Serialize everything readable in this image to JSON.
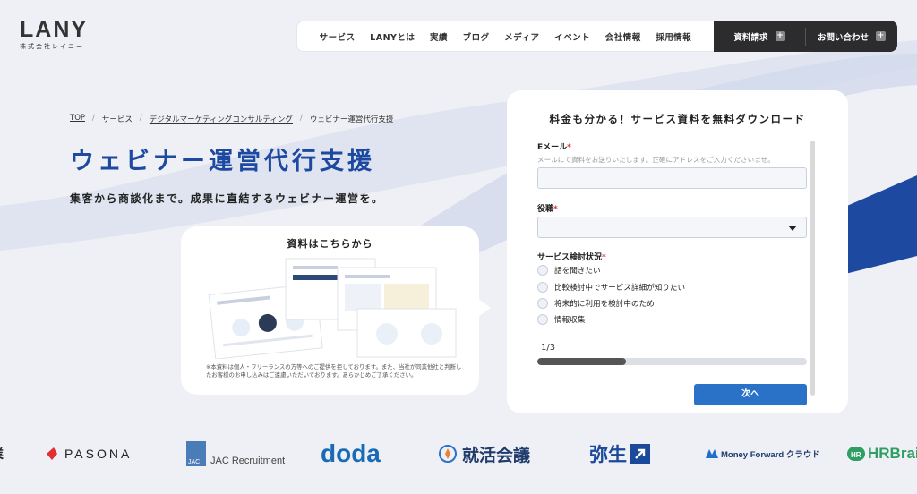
{
  "header": {
    "logo_text": "LANY",
    "logo_sub": "株式会社レイニー",
    "nav": [
      "サービス",
      "LANYとは",
      "実績",
      "ブログ",
      "メディア",
      "イベント",
      "会社情報",
      "採用情報"
    ],
    "cta_doc": "資料請求",
    "cta_contact": "お問い合わせ",
    "cta_icon": "plus-icon"
  },
  "breadcrumb": [
    "TOP",
    "サービス",
    "デジタルマーケティングコンサルティング",
    "ウェビナー運営代行支援"
  ],
  "breadcrumb_sep": "/",
  "hero": {
    "title": "ウェビナー運営代行支援",
    "lead": "集客から商談化まで。成果に直結するウェビナー運営を。"
  },
  "doc_card": {
    "title": "資料はこちらから",
    "note": "※本資料は個人・フリーランスの方等へのご提供を拒しております。また、当社が同業他社と判断したお客様のお申し込みはご遠慮いただいております。あらかじめご了承ください。"
  },
  "form": {
    "title": "料金も分かる！サービス資料を無料ダウンロード",
    "email_label": "Eメール",
    "required_mark": "*",
    "email_hint": "メールにて資料をお送りいたします。正確にアドレスをご入力くださいませ。",
    "email_value": "",
    "role_label": "役職",
    "role_value": "",
    "status_label": "サービス検討状況",
    "options": [
      "話を聞きたい",
      "比較検討中でサービス詳細が知りたい",
      "将来的に利用を検討中のため",
      "情報収集"
    ],
    "step": "1/3",
    "progress": 0.33,
    "next_label": "次へ"
  },
  "client_logos": [
    "PASONA",
    "JAC Recruitment",
    "doda",
    "就活会議",
    "弥生",
    "Money Forward クラウド",
    "HRBrain"
  ],
  "colors": {
    "brand_blue": "#1d4aa0",
    "button_blue": "#2a71c8",
    "dark_nav": "#2c2c2e",
    "background": "#eef0f5"
  }
}
